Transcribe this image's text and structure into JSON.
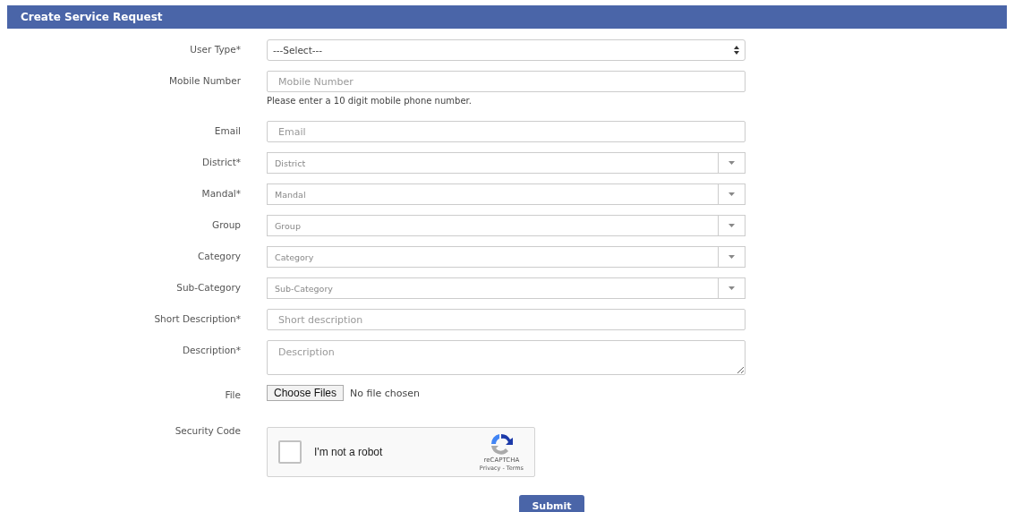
{
  "title": "Create Service Request",
  "fields": [
    {
      "kind": "select",
      "label": "User Type*",
      "value": "---Select---"
    },
    {
      "kind": "text",
      "label": "Mobile Number",
      "placeholder": "Mobile Number",
      "hint": "Please enter a 10 digit mobile phone number."
    },
    {
      "kind": "text",
      "label": "Email",
      "placeholder": "Email"
    },
    {
      "kind": "combo",
      "label": "District*",
      "placeholder": "District"
    },
    {
      "kind": "combo",
      "label": "Mandal*",
      "placeholder": "Mandal"
    },
    {
      "kind": "combo",
      "label": "Group",
      "placeholder": "Group"
    },
    {
      "kind": "combo",
      "label": "Category",
      "placeholder": "Category"
    },
    {
      "kind": "combo",
      "label": "Sub-Category",
      "placeholder": "Sub-Category"
    },
    {
      "kind": "text",
      "label": "Short Description*",
      "placeholder": "Short description"
    },
    {
      "kind": "textarea",
      "label": "Description*",
      "placeholder": "Description"
    },
    {
      "kind": "file",
      "label": "File",
      "button": "Choose Files",
      "status": "No file chosen"
    },
    {
      "kind": "captcha",
      "label": "Security Code",
      "checked": false,
      "text": "I'm not a robot",
      "brand": "reCAPTCHA",
      "links": "Privacy - Terms"
    }
  ],
  "submit": "Submit"
}
